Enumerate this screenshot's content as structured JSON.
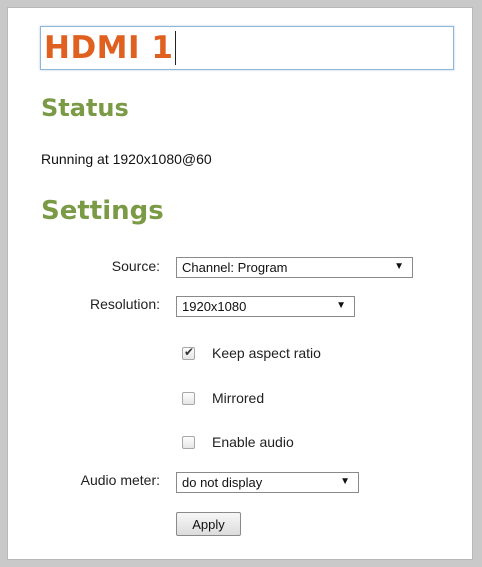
{
  "title": {
    "value": "HDMI 1"
  },
  "status": {
    "heading": "Status",
    "text": "Running at 1920x1080@60"
  },
  "settings": {
    "heading": "Settings",
    "source": {
      "label": "Source:",
      "value": "Channel: Program"
    },
    "resolution": {
      "label": "Resolution:",
      "value": "1920x1080"
    },
    "keep_aspect": {
      "label": "Keep aspect ratio",
      "checked": true
    },
    "mirrored": {
      "label": "Mirrored",
      "checked": false
    },
    "enable_audio": {
      "label": "Enable audio",
      "checked": false
    },
    "audio_meter": {
      "label": "Audio meter:",
      "value": "do not display"
    },
    "apply_label": "Apply"
  },
  "colors": {
    "title": "#e0601f",
    "heading": "#7a9a45",
    "input_border": "#8fb6d8"
  }
}
